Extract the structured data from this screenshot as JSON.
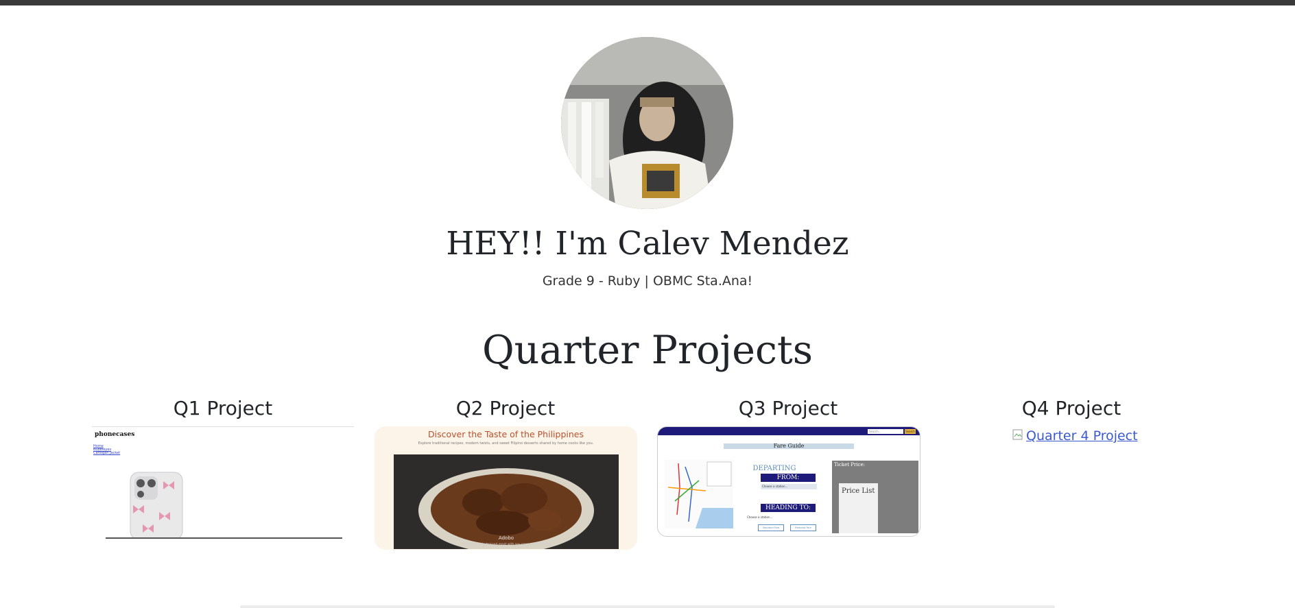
{
  "hero": {
    "title": "HEY!! I'm Calev Mendez",
    "subtitle": "Grade 9 - Ruby | OBMC Sta.Ana!"
  },
  "projects_section": {
    "title": "Quarter Projects",
    "items": [
      {
        "title": "Q1 Project",
        "preview": {
          "brand": "phonecases",
          "links": [
            "Home",
            "Bubbleyes",
            "Cardigan Jacket"
          ]
        }
      },
      {
        "title": "Q2 Project",
        "preview": {
          "heading": "Discover the Taste of the Philippines",
          "subheading": "Explore traditional recipes, modern twists, and sweet Filipino desserts shared by home cooks like you.",
          "caption": "Adobo",
          "caption_sub": "A Filipino-style braised meat with soy sauce and vinegar"
        }
      },
      {
        "title": "Q3 Project",
        "preview": {
          "search_placeholder": "Search...",
          "search_button": "Search",
          "page_title": "Fare Guide",
          "departing": "DEPARTING",
          "from_label": "FROM:",
          "from_select": "Choose a station...",
          "heading_label": "HEADING TO:",
          "to_select": "Choose a station...",
          "btn_standard": "Standard Fare",
          "btn_reduced": "Reduced Fare",
          "ticket_title": "Ticket Price:",
          "price_list": "Price List"
        }
      },
      {
        "title": "Q4 Project",
        "alt_text": "Quarter 4 Project"
      }
    ]
  },
  "colors": {
    "top_bar": "#3a3a3a",
    "link": "#3a59d1",
    "q3_nav": "#1e1a7a",
    "q2_heading": "#b5522f"
  }
}
